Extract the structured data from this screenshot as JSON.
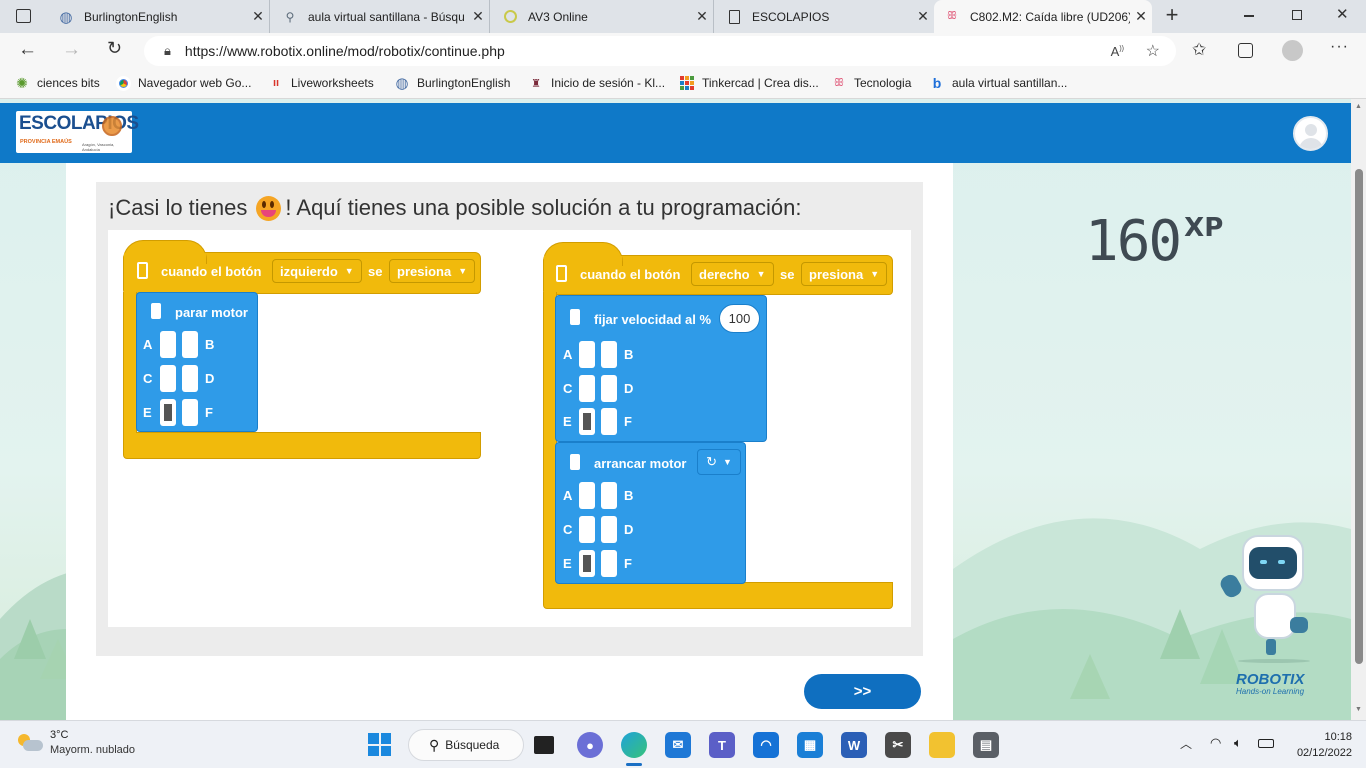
{
  "browser": {
    "tabs": [
      {
        "title": "BurlingtonEnglish"
      },
      {
        "title": "aula virtual santillana - Búsqu"
      },
      {
        "title": "AV3 Online"
      },
      {
        "title": "ESCOLAPIOS"
      },
      {
        "title": "C802.M2: Caída libre (UD206)"
      }
    ],
    "url": "https://www.robotix.online/mod/robotix/continue.php",
    "bookmarks": [
      {
        "label": "ciences bits"
      },
      {
        "label": "Navegador web Go..."
      },
      {
        "label": "Liveworksheets"
      },
      {
        "label": "BurlingtonEnglish"
      },
      {
        "label": "Inicio de sesión - Kl..."
      },
      {
        "label": "Tinkercad | Crea dis..."
      },
      {
        "label": "Tecnologia"
      },
      {
        "label": "aula virtual santillan..."
      }
    ]
  },
  "site": {
    "logo_text": "ESCOLAPIOS",
    "logo_sub": "PROVINCIA EMAÚS",
    "logo_sub2": "Aragón, Vasconia, Andalucía"
  },
  "panel": {
    "title_part1": "¡Casi lo tienes",
    "title_part2": "! Aquí tienes una posible solución a tu programación:",
    "xp_value": "160",
    "xp_unit": "XP",
    "next_label": ">>"
  },
  "blocks": {
    "left": {
      "event_label": "cuando el botón",
      "button_value": "izquierdo",
      "se_label": "se",
      "action_value": "presiona",
      "cmd_label": "parar motor",
      "ports": [
        "A",
        "B",
        "C",
        "D",
        "E",
        "F"
      ]
    },
    "right": {
      "event_label": "cuando el botón",
      "button_value": "derecho",
      "se_label": "se",
      "action_value": "presiona",
      "cmd1_label": "fijar velocidad al %",
      "cmd1_value": "100",
      "cmd2_label": "arrancar motor",
      "ports": [
        "A",
        "B",
        "C",
        "D",
        "E",
        "F"
      ]
    }
  },
  "mascot": {
    "brand": "ROBOTIX",
    "tagline": "Hands-on Learning"
  },
  "taskbar": {
    "weather_temp": "3°C",
    "weather_desc": "Mayorm. nublado",
    "search_label": "Búsqueda",
    "time": "10:18",
    "date": "02/12/2022"
  },
  "colors": {
    "header_blue": "#0f79c8",
    "block_yellow": "#f1ba0c",
    "block_blue": "#2f9be8",
    "next_button": "#0f6fc0"
  }
}
